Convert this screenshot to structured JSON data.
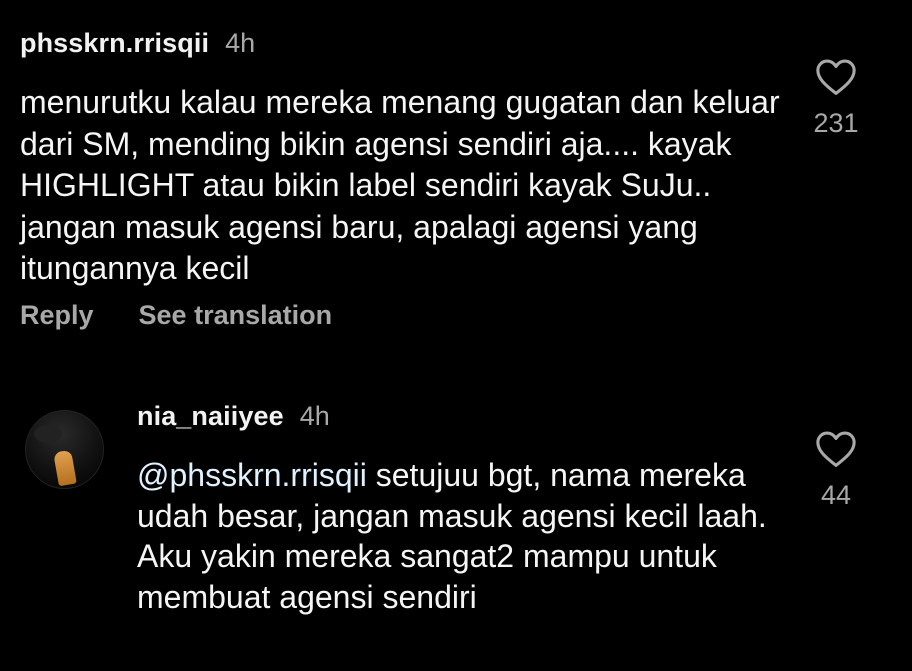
{
  "comments": [
    {
      "username": "phsskrn.rrisqii",
      "timestamp": "4h",
      "text": "menurutku kalau mereka menang gugatan dan keluar dari SM, mending bikin agensi sendiri aja.... kayak HIGHLIGHT atau bikin label sendiri kayak SuJu.. jangan masuk agensi baru, apalagi agensi yang itungannya kecil",
      "actions": {
        "reply_label": "Reply",
        "translate_label": "See translation"
      },
      "likes": "231"
    },
    {
      "username": "nia_naiiyee",
      "timestamp": "4h",
      "mention": "@phsskrn.rrisqii",
      "text": " setujuu bgt, nama mereka udah besar, jangan masuk agensi kecil laah. Aku yakin mereka sangat2 mampu untuk membuat agensi sendiri",
      "likes": "44"
    }
  ],
  "colors": {
    "background": "#000000",
    "primary_text": "#f5f5f5",
    "secondary_text": "#a8a8a8",
    "mention": "#e0f1ff"
  },
  "icons": {
    "like": "heart-outline-icon",
    "avatar": "profile-picture"
  }
}
